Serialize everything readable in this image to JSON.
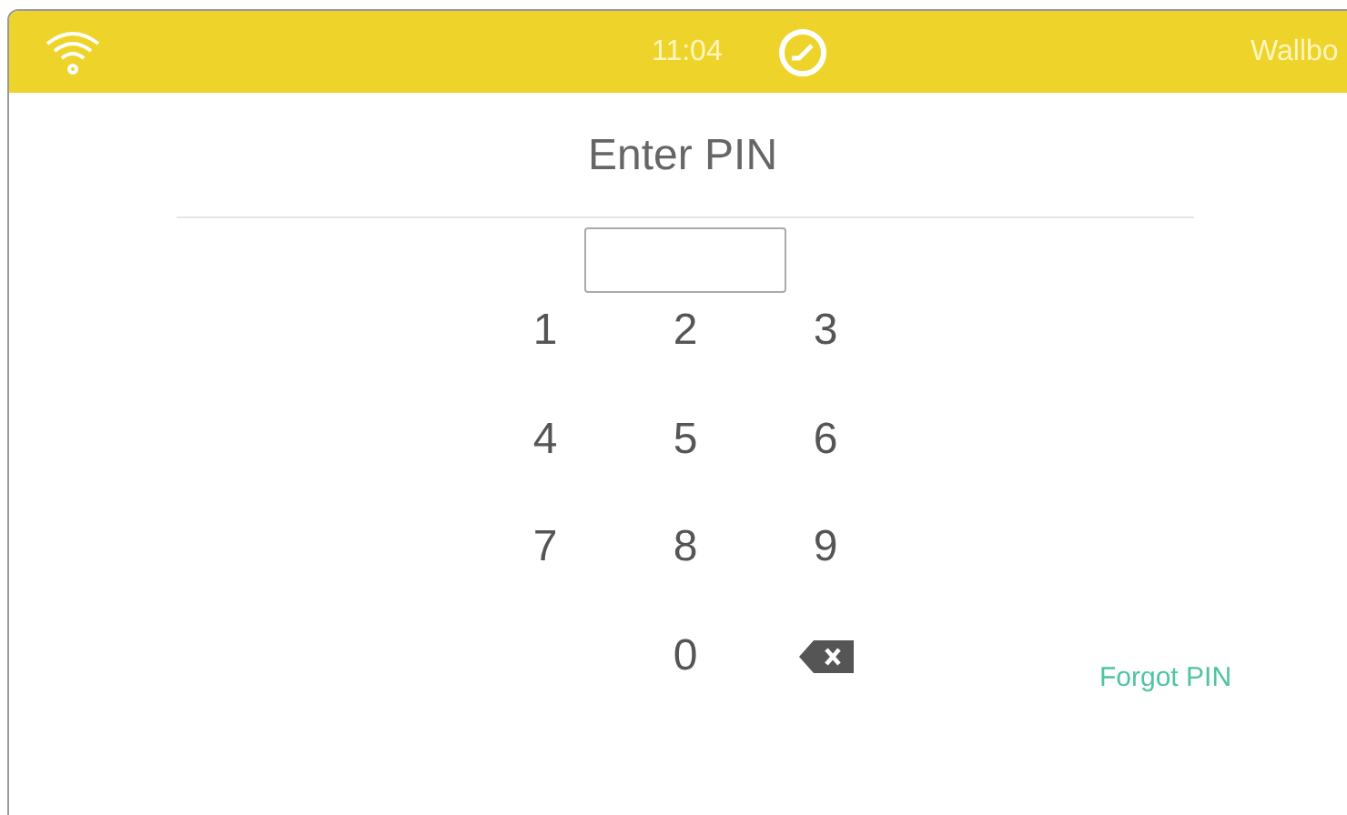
{
  "status_bar": {
    "time": "11:04",
    "device": "Wallbo"
  },
  "title": "Enter PIN",
  "keypad": [
    {
      "kind": "digit",
      "label": "1"
    },
    {
      "kind": "digit",
      "label": "2"
    },
    {
      "kind": "digit",
      "label": "3"
    },
    {
      "kind": "digit",
      "label": "4"
    },
    {
      "kind": "digit",
      "label": "5"
    },
    {
      "kind": "digit",
      "label": "6"
    },
    {
      "kind": "digit",
      "label": "7"
    },
    {
      "kind": "digit",
      "label": "8"
    },
    {
      "kind": "digit",
      "label": "9"
    },
    {
      "kind": "empty"
    },
    {
      "kind": "digit",
      "label": "0"
    },
    {
      "kind": "backspace"
    }
  ],
  "forgot_link": "Forgot PIN"
}
